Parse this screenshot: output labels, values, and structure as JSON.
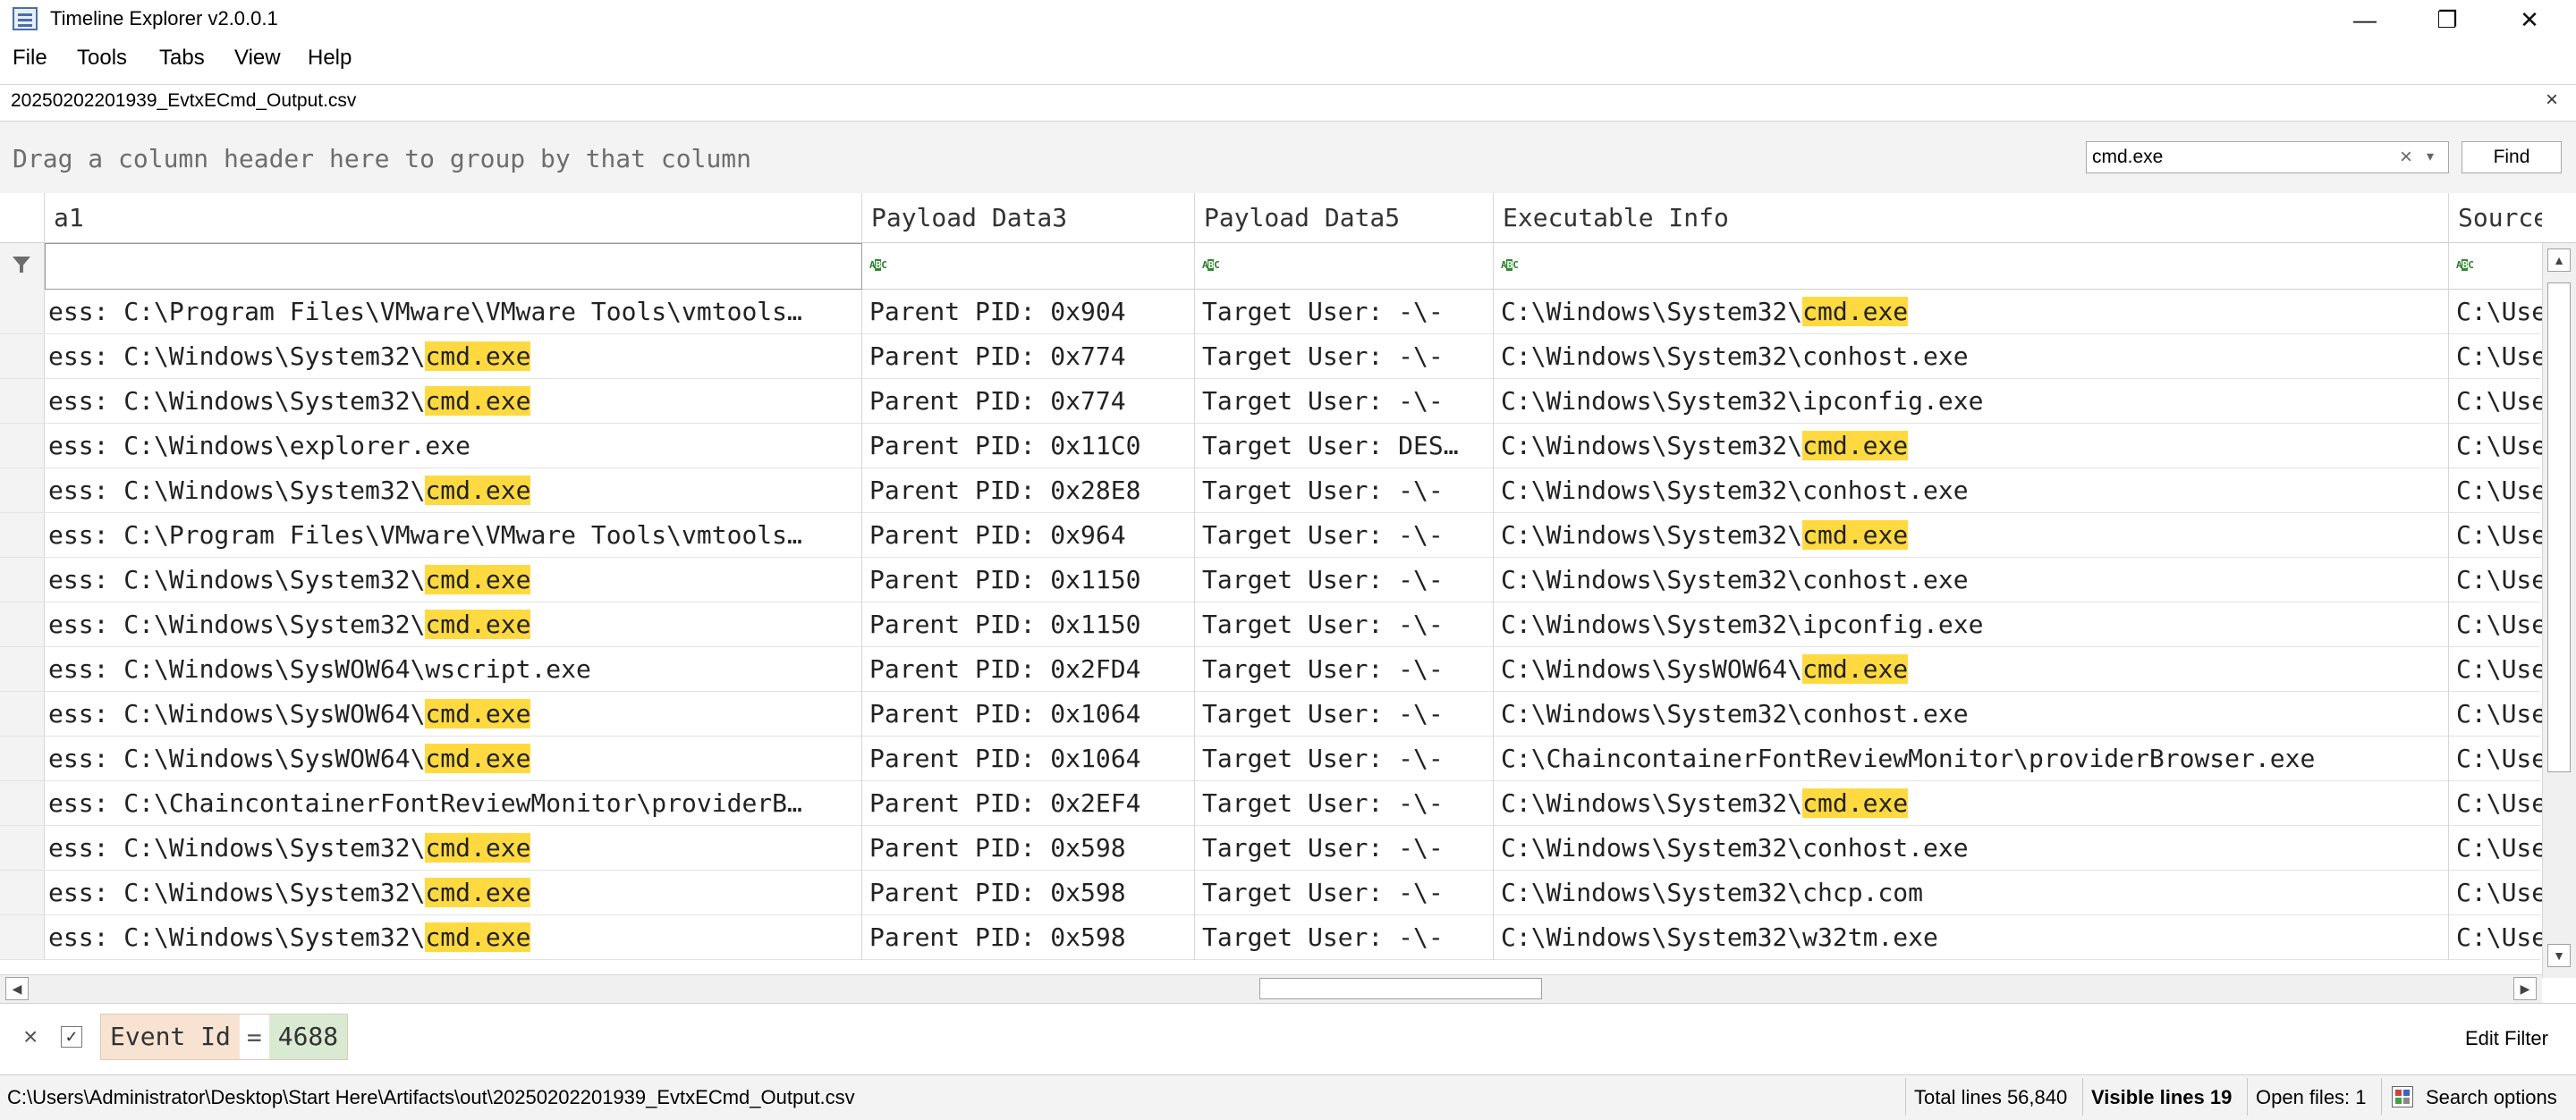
{
  "window": {
    "title": "Timeline Explorer v2.0.0.1"
  },
  "menu": [
    "File",
    "Tools",
    "Tabs",
    "View",
    "Help"
  ],
  "tab": {
    "label": "20250202201939_EvtxECmd_Output.csv",
    "close": "×"
  },
  "groupbar": {
    "hint": "Drag a column header here to group by that column",
    "search_value": "cmd.exe",
    "clear_icon": "×",
    "dropdown_icon": "▾",
    "find_label": "Find"
  },
  "columns": [
    "a1",
    "Payload Data3",
    "Payload Data5",
    "Executable Info",
    "Source"
  ],
  "highlight_term": "cmd.exe",
  "rows": [
    {
      "c1": "ess: C:\\Program Files\\VMware\\VMware Tools\\vmtools…",
      "c2": "Parent PID: 0x904",
      "c3": "Target User: -\\-",
      "c4": "C:\\Windows\\System32\\cmd.exe",
      "c5": "C:\\Use"
    },
    {
      "c1": "ess: C:\\Windows\\System32\\cmd.exe",
      "c2": "Parent PID: 0x774",
      "c3": "Target User: -\\-",
      "c4": "C:\\Windows\\System32\\conhost.exe",
      "c5": "C:\\Use"
    },
    {
      "c1": "ess: C:\\Windows\\System32\\cmd.exe",
      "c2": "Parent PID: 0x774",
      "c3": "Target User: -\\-",
      "c4": "C:\\Windows\\System32\\ipconfig.exe",
      "c5": "C:\\Use"
    },
    {
      "c1": "ess: C:\\Windows\\explorer.exe",
      "c2": "Parent PID: 0x11C0",
      "c3": "Target User: DES…",
      "c4": "C:\\Windows\\System32\\cmd.exe",
      "c5": "C:\\Use"
    },
    {
      "c1": "ess: C:\\Windows\\System32\\cmd.exe",
      "c2": "Parent PID: 0x28E8",
      "c3": "Target User: -\\-",
      "c4": "C:\\Windows\\System32\\conhost.exe",
      "c5": "C:\\Use"
    },
    {
      "c1": "ess: C:\\Program Files\\VMware\\VMware Tools\\vmtools…",
      "c2": "Parent PID: 0x964",
      "c3": "Target User: -\\-",
      "c4": "C:\\Windows\\System32\\cmd.exe",
      "c5": "C:\\Use"
    },
    {
      "c1": "ess: C:\\Windows\\System32\\cmd.exe",
      "c2": "Parent PID: 0x1150",
      "c3": "Target User: -\\-",
      "c4": "C:\\Windows\\System32\\conhost.exe",
      "c5": "C:\\Use"
    },
    {
      "c1": "ess: C:\\Windows\\System32\\cmd.exe",
      "c2": "Parent PID: 0x1150",
      "c3": "Target User: -\\-",
      "c4": "C:\\Windows\\System32\\ipconfig.exe",
      "c5": "C:\\Use"
    },
    {
      "c1": "ess: C:\\Windows\\SysWOW64\\wscript.exe",
      "c2": "Parent PID: 0x2FD4",
      "c3": "Target User: -\\-",
      "c4": "C:\\Windows\\SysWOW64\\cmd.exe",
      "c5": "C:\\Use"
    },
    {
      "c1": "ess: C:\\Windows\\SysWOW64\\cmd.exe",
      "c2": "Parent PID: 0x1064",
      "c3": "Target User: -\\-",
      "c4": "C:\\Windows\\System32\\conhost.exe",
      "c5": "C:\\Use"
    },
    {
      "c1": "ess: C:\\Windows\\SysWOW64\\cmd.exe",
      "c2": "Parent PID: 0x1064",
      "c3": "Target User: -\\-",
      "c4": "C:\\ChaincontainerFontReviewMonitor\\providerBrowser.exe",
      "c5": "C:\\Use"
    },
    {
      "c1": "ess: C:\\ChaincontainerFontReviewMonitor\\providerB…",
      "c2": "Parent PID: 0x2EF4",
      "c3": "Target User: -\\-",
      "c4": "C:\\Windows\\System32\\cmd.exe",
      "c5": "C:\\Use"
    },
    {
      "c1": "ess: C:\\Windows\\System32\\cmd.exe",
      "c2": "Parent PID: 0x598",
      "c3": "Target User: -\\-",
      "c4": "C:\\Windows\\System32\\conhost.exe",
      "c5": "C:\\Use"
    },
    {
      "c1": "ess: C:\\Windows\\System32\\cmd.exe",
      "c2": "Parent PID: 0x598",
      "c3": "Target User: -\\-",
      "c4": "C:\\Windows\\System32\\chcp.com",
      "c5": "C:\\Use"
    },
    {
      "c1": "ess: C:\\Windows\\System32\\cmd.exe",
      "c2": "Parent PID: 0x598",
      "c3": "Target User: -\\-",
      "c4": "C:\\Windows\\System32\\w32tm.exe",
      "c5": "C:\\Use"
    }
  ],
  "filter": {
    "field": "Event Id",
    "operator": "=",
    "value": "4688",
    "edit_label": "Edit Filter",
    "remove_icon": "×",
    "enabled_icon": "✓"
  },
  "status": {
    "path": "C:\\Users\\Administrator\\Desktop\\Start Here\\Artifacts\\out\\20250202201939_EvtxECmd_Output.csv",
    "total_lines": "Total lines 56,840",
    "visible_lines": "Visible lines 19",
    "open_files": "Open files: 1",
    "search_options": "Search options"
  },
  "colors": {
    "highlight": "#ffd940",
    "filter_field_bg": "#f8e3d2",
    "filter_value_bg": "#d9ead3"
  }
}
